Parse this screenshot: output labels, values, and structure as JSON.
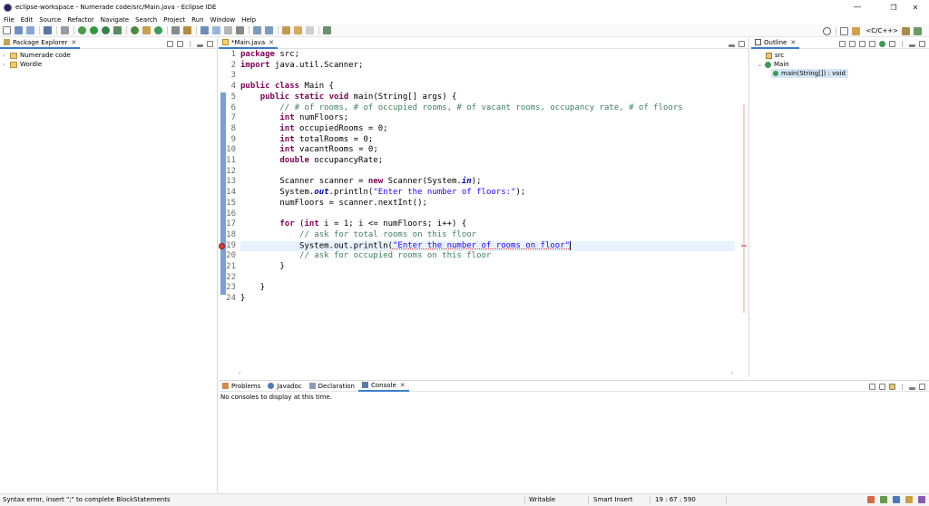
{
  "window": {
    "title": "eclipse-workspace - Numerade code/src/Main.java - Eclipse IDE",
    "minimize": "—",
    "maximize": "❐",
    "close": "✕"
  },
  "menu": [
    "File",
    "Edit",
    "Source",
    "Refactor",
    "Navigate",
    "Search",
    "Project",
    "Run",
    "Window",
    "Help"
  ],
  "toolbar": {
    "perspective_label": "<C/C++>"
  },
  "package_explorer": {
    "tab_label": "Package Explorer",
    "projects": [
      "Numerade code",
      "Wordle"
    ]
  },
  "editor": {
    "tab_label": "*Main.java",
    "line_numbers": [
      "1",
      "2",
      "3",
      "4",
      "5",
      "6",
      "7",
      "8",
      "9",
      "10",
      "11",
      "12",
      "13",
      "14",
      "15",
      "16",
      "17",
      "18",
      "19",
      "20",
      "21",
      "22",
      "23",
      "24"
    ],
    "lines": [
      "package src;",
      "import java.util.Scanner;",
      "",
      "public class Main {",
      "    public static void main(String[] args) {",
      "        // # of rooms, # of occupied rooms, # of vacant rooms, occupancy rate, # of floors",
      "        int numFloors;",
      "        int occupiedRooms = 0;",
      "        int totalRooms = 0;",
      "        int vacantRooms = 0;",
      "        double occupancyRate;",
      "",
      "        Scanner scanner = new Scanner(System.in);",
      "        System.out.println(\"Enter the number of floors:\");",
      "        numFloors = scanner.nextInt();",
      "",
      "        for (int i = 1; i <= numFloors; i++) {",
      "            // ask for total rooms on this floor",
      "            System.out.println(\"Enter the number of rooms on floor\"",
      "            // ask for occupied rooms on this floor",
      "        }",
      "",
      "    }",
      "}"
    ]
  },
  "outline": {
    "tab_label": "Outline",
    "items": [
      "src",
      "Main",
      "main(String[]) : void"
    ]
  },
  "bottom_panel": {
    "tabs": [
      "Problems",
      "Javadoc",
      "Declaration",
      "Console"
    ],
    "console_message": "No consoles to display at this time."
  },
  "status_bar": {
    "message": "Syntax error, insert \";\" to complete BlockStatements",
    "mode": "Writable",
    "insert_mode": "Smart Insert",
    "position": "19 : 67 : 590"
  },
  "colors": {
    "keyword": "#7f0055",
    "comment": "#3f7f5f",
    "string": "#2a00ff",
    "field": "#0000c0",
    "active_tab_accent": "#3d7dca",
    "error": "#d93a3a"
  }
}
